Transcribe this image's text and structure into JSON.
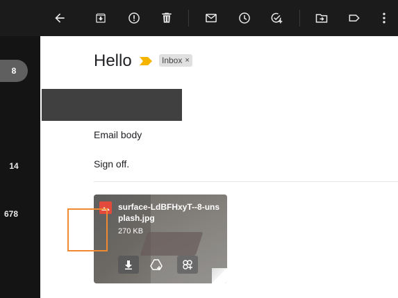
{
  "toolbar": {
    "icons": [
      "back-arrow-icon",
      "archive-icon",
      "report-spam-icon",
      "delete-icon",
      "mark-unread-icon",
      "snooze-icon",
      "add-to-tasks-icon",
      "move-to-icon",
      "label-icon",
      "more-vert-icon"
    ]
  },
  "left_rail": {
    "active_count": "8",
    "counts": [
      "14",
      "678"
    ]
  },
  "email": {
    "subject": "Hello",
    "label": "Inbox",
    "label_remove": "×",
    "body": "Email body",
    "signoff": "Sign off."
  },
  "attachment": {
    "filename": "surface-LdBFHxyT--8-unsplash.jpg",
    "size": "270 KB",
    "actions": [
      "download",
      "add-to-drive",
      "save-to-photos"
    ]
  },
  "colors": {
    "toolbar_bg": "#1b1b1b",
    "page_bg": "#141414",
    "importance_marker": "#f4b400",
    "highlight": "#ef8a32"
  }
}
